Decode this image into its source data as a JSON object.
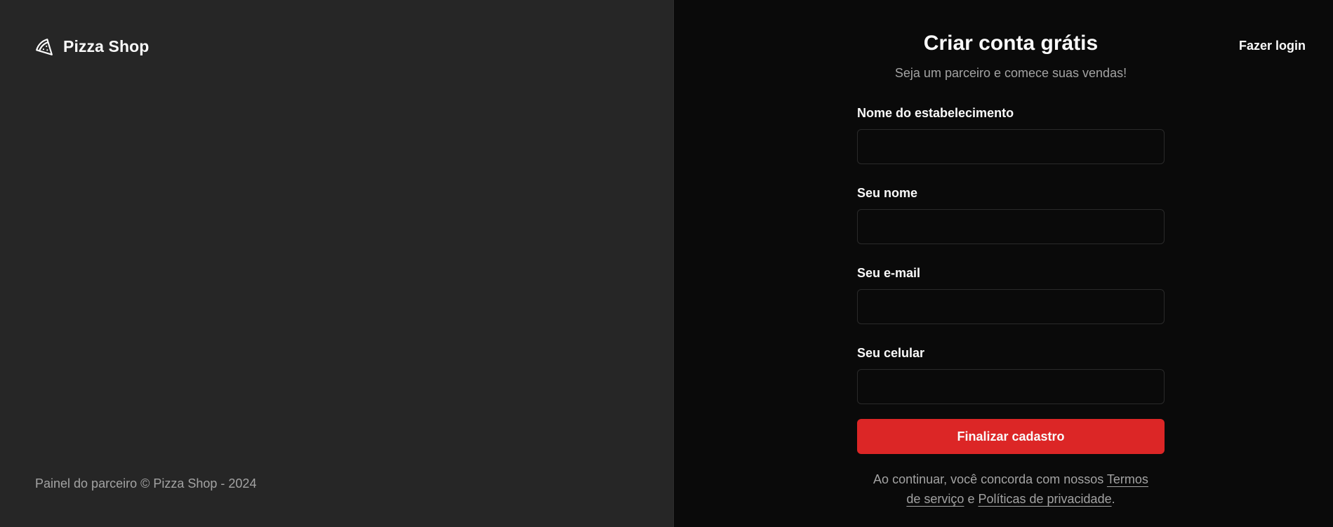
{
  "brand": {
    "icon": "pizza-icon",
    "name": "Pizza Shop"
  },
  "left_footer": {
    "text": "Painel do parceiro © Pizza Shop - 2024"
  },
  "header": {
    "login_link": "Fazer login"
  },
  "form": {
    "title": "Criar conta grátis",
    "subtitle": "Seja um parceiro e comece suas vendas!",
    "fields": [
      {
        "label": "Nome do estabelecimento",
        "value": "",
        "placeholder": ""
      },
      {
        "label": "Seu nome",
        "value": "",
        "placeholder": ""
      },
      {
        "label": "Seu e-mail",
        "value": "",
        "placeholder": ""
      },
      {
        "label": "Seu celular",
        "value": "",
        "placeholder": ""
      }
    ],
    "submit_label": "Finalizar cadastro"
  },
  "legal": {
    "prefix": "Ao continuar, você concorda com nossos",
    "terms_link": "Termos de serviço",
    "connector": "e",
    "privacy_link": "Políticas de privacidade",
    "suffix": "."
  },
  "colors": {
    "left_background": "#262626",
    "right_background": "#0a0a0a",
    "accent": "#dc2626",
    "text_primary": "#fafafa",
    "text_muted": "#a3a3a3",
    "input_border": "#2a2a2a"
  }
}
